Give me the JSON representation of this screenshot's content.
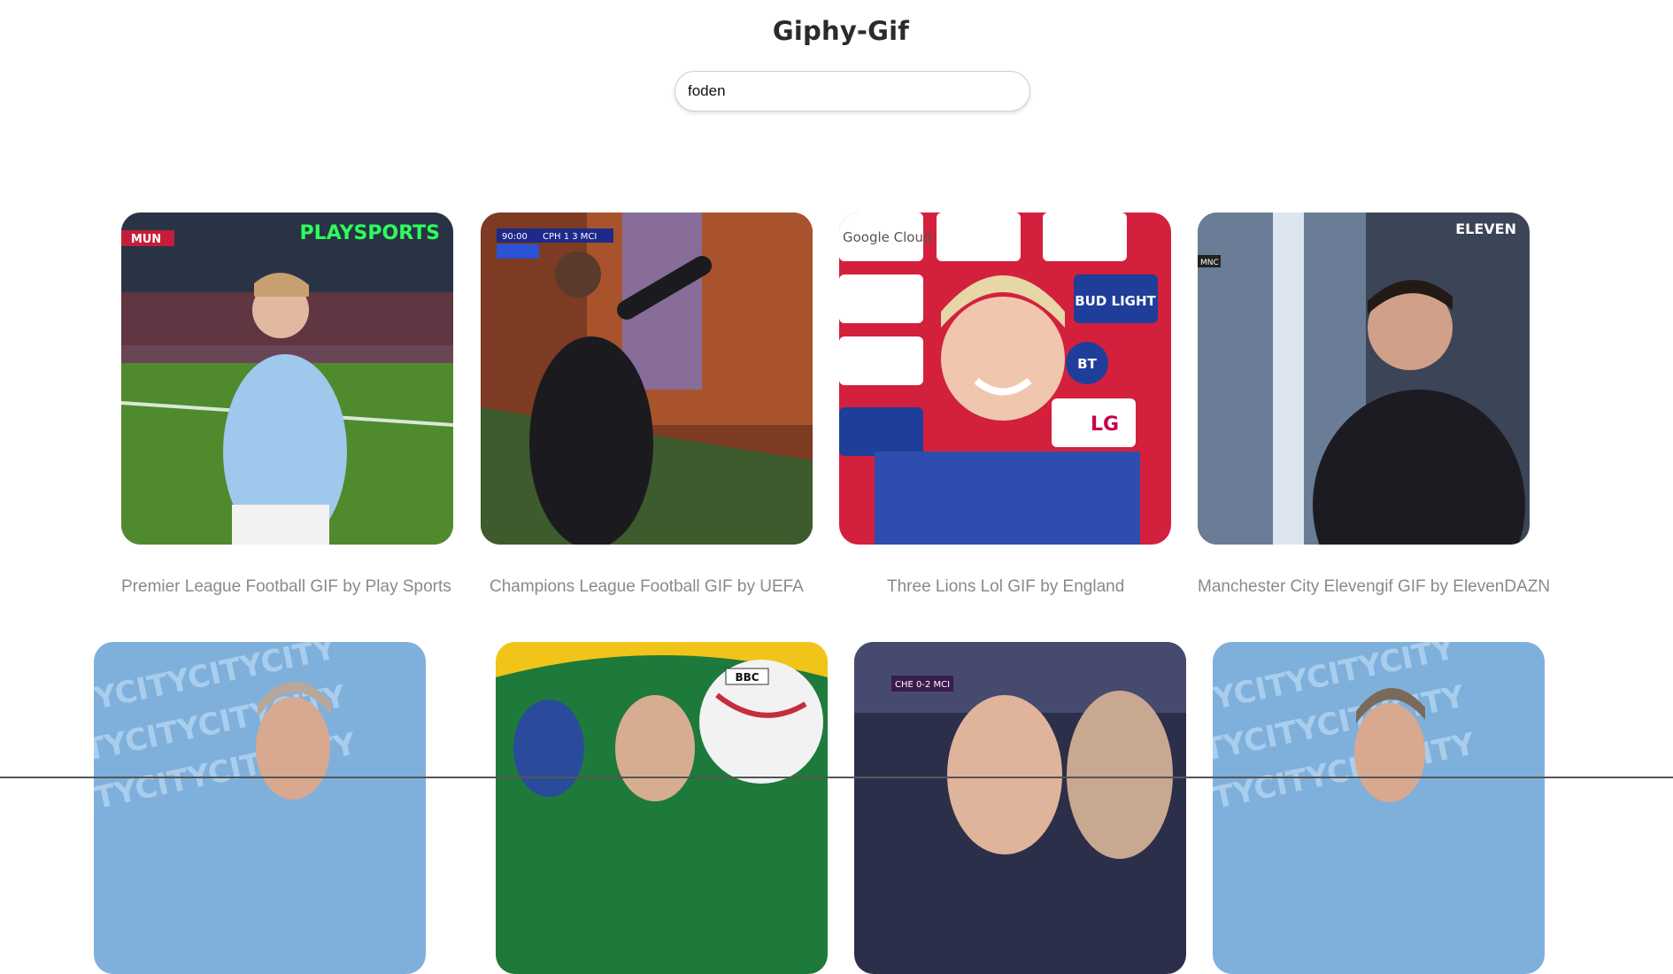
{
  "header": {
    "title": "Giphy-Gif"
  },
  "search": {
    "value": "foden",
    "placeholder": ""
  },
  "results": [
    {
      "caption": "Premier League Football GIF by Play Sports",
      "overlay": "PLAYSPORTS",
      "score": "MUN"
    },
    {
      "caption": "Champions League Football GIF by UEFA",
      "overlay": "CPH 1 3 MCI",
      "clock": "90:00"
    },
    {
      "caption": "Three Lions Lol GIF by England",
      "sponsor1": "Google Cloud",
      "sponsor2": "BUD LIGHT",
      "sponsor3": "BT",
      "sponsor4": "LG"
    },
    {
      "caption": "Manchester City Elevengif GIF by ElevenDAZN",
      "overlay": "ELEVEN",
      "small": "MNC"
    },
    {
      "caption": "",
      "pattern": "CITYCITYCITYCITY"
    },
    {
      "caption": "",
      "badge": "BBC"
    },
    {
      "caption": "",
      "score": "CHE 0-2 MCI"
    },
    {
      "caption": "",
      "pattern": "CITYCITYCITYCITY"
    }
  ]
}
